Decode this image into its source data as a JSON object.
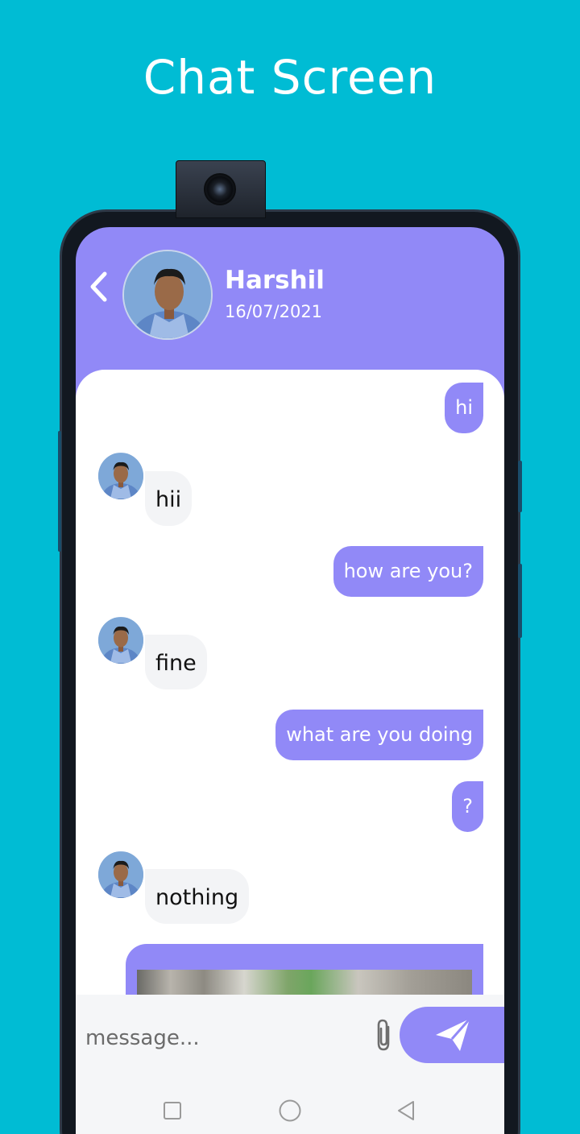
{
  "headline": "Chat Screen",
  "colors": {
    "background": "#00bcd4",
    "accent": "#9189f7",
    "incoming_bubble": "#f3f4f6"
  },
  "header": {
    "back_icon": "chevron-left-icon",
    "contact_name": "Harshil",
    "date": "16/07/2021"
  },
  "messages": [
    {
      "direction": "out",
      "text": "hi"
    },
    {
      "direction": "in",
      "text": "hii"
    },
    {
      "direction": "out",
      "text": "how are you?"
    },
    {
      "direction": "in",
      "text": "fine"
    },
    {
      "direction": "out",
      "text": "what are you doing"
    },
    {
      "direction": "out",
      "text": "?"
    },
    {
      "direction": "in",
      "text": "nothing"
    },
    {
      "direction": "out",
      "type": "image"
    }
  ],
  "composer": {
    "placeholder": "message...",
    "attach_icon": "paperclip-icon",
    "send_icon": "send-icon"
  },
  "nav": {
    "recent_icon": "square-icon",
    "home_icon": "circle-icon",
    "back_icon": "triangle-back-icon"
  }
}
